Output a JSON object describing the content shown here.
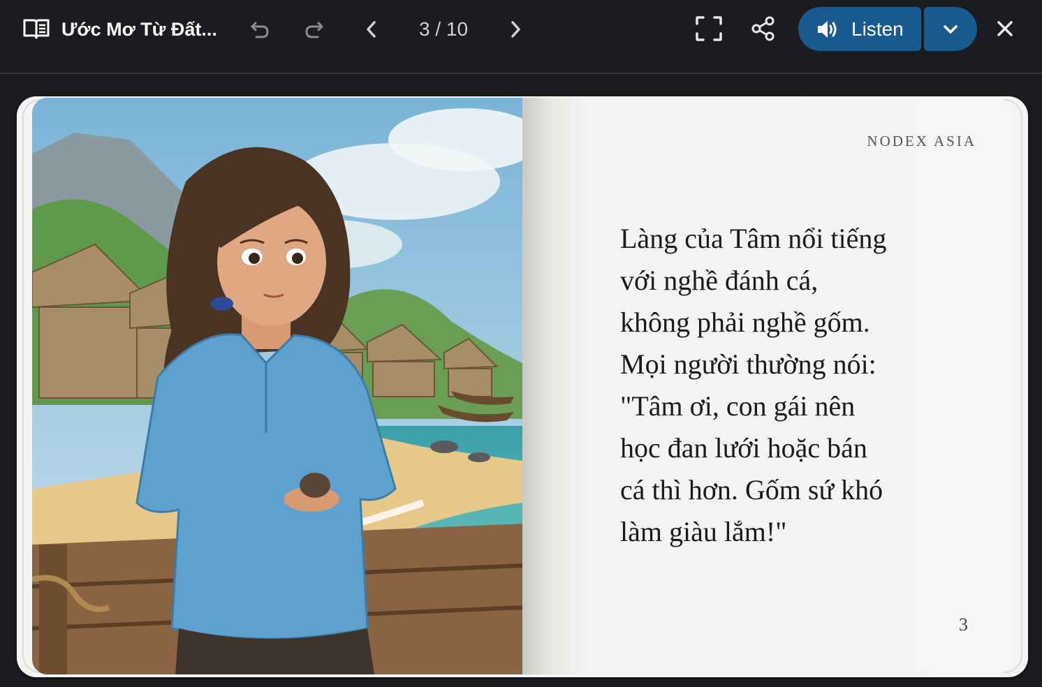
{
  "header": {
    "book_title": "Ước Mơ Từ Đất...",
    "page_indicator": "3 / 10",
    "listen_label": "Listen"
  },
  "icons": {
    "book": "open-book-icon",
    "undo": "undo-icon",
    "redo": "redo-icon",
    "prev": "chevron-left-icon",
    "next": "chevron-right-icon",
    "fullscreen": "fullscreen-icon",
    "share": "share-icon",
    "speaker": "speaker-icon",
    "dropdown": "chevron-down-icon",
    "close": "close-icon"
  },
  "page": {
    "publisher": "NODEX ASIA",
    "lines": [
      "Làng của Tâm nổi tiếng",
      "với nghề đánh cá,",
      "không phải nghề gốm.",
      "Mọi người thường nói:",
      "\"Tâm ơi, con gái nên",
      "học đan lưới hoặc bán",
      "cá thì hơn. Gốm sứ khó",
      "làm giàu lắm!\""
    ],
    "number": "3"
  },
  "colors": {
    "background": "#1b1c1f",
    "accent": "#1a5b8f",
    "page": "#f6f6f4"
  }
}
